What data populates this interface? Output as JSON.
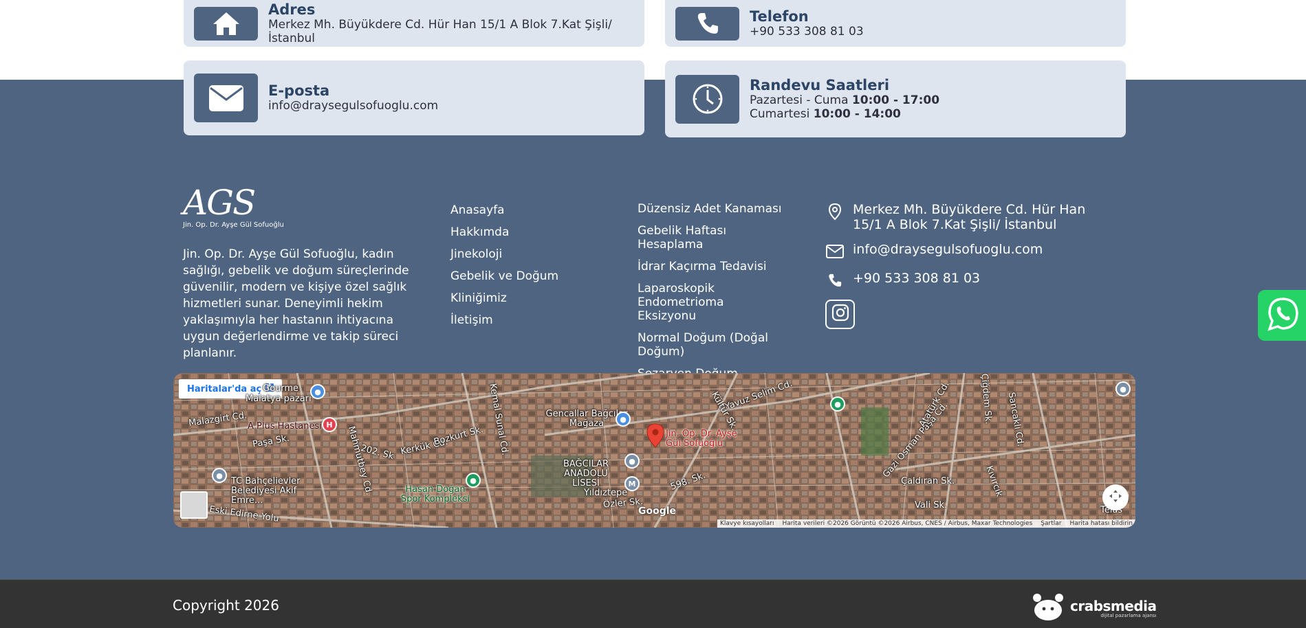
{
  "cards": {
    "address": {
      "title": "Adres",
      "value": "Merkez Mh. Büyükdere Cd. Hür Han 15/1 A Blok 7.Kat Şişli/ İstanbul",
      "icon": "home-icon"
    },
    "phone": {
      "title": "Telefon",
      "value": "+90 533 308 81 03",
      "icon": "phone-icon"
    },
    "email": {
      "title": "E-posta",
      "value": "info@draysegulsofuoglu.com",
      "icon": "envelope-icon"
    },
    "hours": {
      "title": "Randevu Saatleri",
      "weekday_label": "Pazartesi - Cuma",
      "weekday_time": "10:00 - 17:00",
      "saturday_label": "Cumartesi",
      "saturday_time": "10:00 - 14:00",
      "icon": "clock-icon"
    }
  },
  "footer": {
    "logo_mark": "AGS",
    "logo_subtitle": "Jin. Op. Dr. Ayşe Gül Sofuoğlu",
    "about": "Jin. Op. Dr. Ayşe Gül Sofuoğlu, kadın sağlığı, gebelik ve doğum süreçlerinde güvenilir, modern ve kişiye özel sağlık hizmetleri sunar. Deneyimli hekim yaklaşımıyla her hastanın ihtiyacına uygun değerlendirme ve takip süreci planlanır.",
    "nav_links": [
      "Anasayfa",
      "Hakkımda",
      "Jinekoloji",
      "Gebelik ve Doğum",
      "Kliniğimiz",
      "İletişim"
    ],
    "service_links": [
      "Düzensiz Adet Kanaması",
      "Gebelik Haftası Hesaplama",
      "İdrar Kaçırma Tedavisi",
      "Laparoskopik Endometrioma Eksizyonu",
      "Normal Doğum (Doğal Doğum)",
      "Sezaryen Doğum"
    ],
    "contact": {
      "address": "Merkez Mh. Büyükdere Cd. Hür Han 15/1 A Blok 7.Kat Şişli/ İstanbul",
      "email": "info@draysegulsofuoglu.com",
      "phone": "+90 533 308 81 03"
    }
  },
  "map": {
    "open_label": "Haritalar'da aç",
    "marker_label": "Jin. Op. Dr. Ayşe Gül Sofuoğlu",
    "labels": [
      "Malazgirt Cd.",
      "A Plus Hastanesi",
      "Malatya pazarı",
      "Gourme",
      "TC Bahçelievler Belediyesi Akif Emre...",
      "Eski Edirne Yolu",
      "Hasan Doğan Spor Kompleksi",
      "BAĞCILAR ANADOLU LİSESİ",
      "Yıldıztepe",
      "Gencallar Bağcılar Mağaza",
      "Kemal Sunal Cd.",
      "Kerkük Cd.",
      "Bozkurt Sk.",
      "202. Sk",
      "Mahmutbey Cd.",
      "Paşa Sk.",
      "Gazi Osman Paşa Cd.",
      "Atatürk Cd.",
      "Çaldıran Sk.",
      "Vali Sk.",
      "Kıvırcık",
      "Sancaklı Cd.",
      "Çiğdem Sk.",
      "Özler Sk.",
      "598. Sk.",
      "Yavuz Selim Cd.",
      "Kültür Sk.",
      "Teias"
    ],
    "google_label": "Google",
    "attribution": [
      "Klavye kısayolları",
      "Harita verileri ©2026 Görüntü ©2026 Airbus, CNES / Airbus, Maxar Technologies",
      "Şartlar",
      "Harita hatası bildirin"
    ]
  },
  "bottom": {
    "copyright": "Copyright 2026",
    "agency_name": "crabsmedia",
    "agency_tagline": "dijital pazarlama ajansı"
  }
}
